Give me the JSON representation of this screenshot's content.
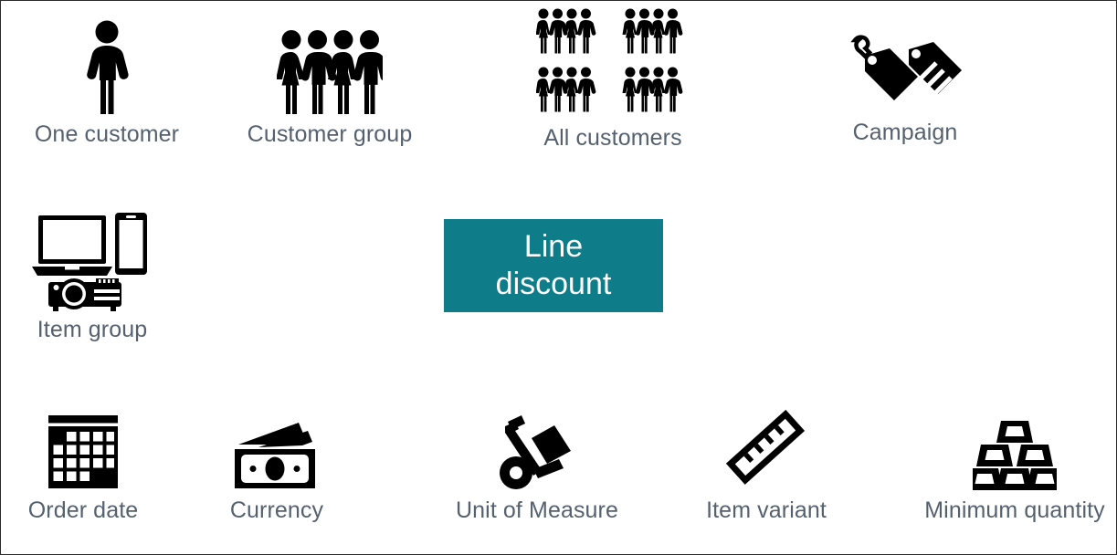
{
  "diagram": {
    "center": {
      "label": "Line discount",
      "line1": "Line",
      "line2": "discount",
      "background_color": "#0f7c8a",
      "text_color": "#ffffff"
    },
    "label_color": "#55616f",
    "icon_color": "#000000",
    "background_color": "#ffffff",
    "nodes": [
      {
        "id": "one-customer",
        "label": "One customer",
        "icon": "single-person-icon"
      },
      {
        "id": "customer-group",
        "label": "Customer group",
        "icon": "people-group-icon"
      },
      {
        "id": "all-customers",
        "label": "All customers",
        "icon": "all-people-grid-icon"
      },
      {
        "id": "campaign",
        "label": "Campaign",
        "icon": "price-tags-icon"
      },
      {
        "id": "item-group",
        "label": "Item group",
        "icon": "devices-icon"
      },
      {
        "id": "order-date",
        "label": "Order date",
        "icon": "calendar-icon"
      },
      {
        "id": "currency",
        "label": "Currency",
        "icon": "banknotes-icon"
      },
      {
        "id": "unit-of-measure",
        "label": "Unit of Measure",
        "icon": "hand-truck-icon"
      },
      {
        "id": "item-variant",
        "label": "Item variant",
        "icon": "ruler-icon"
      },
      {
        "id": "minimum-quantity",
        "label": "Minimum quantity",
        "icon": "stacked-bars-icon"
      }
    ]
  }
}
